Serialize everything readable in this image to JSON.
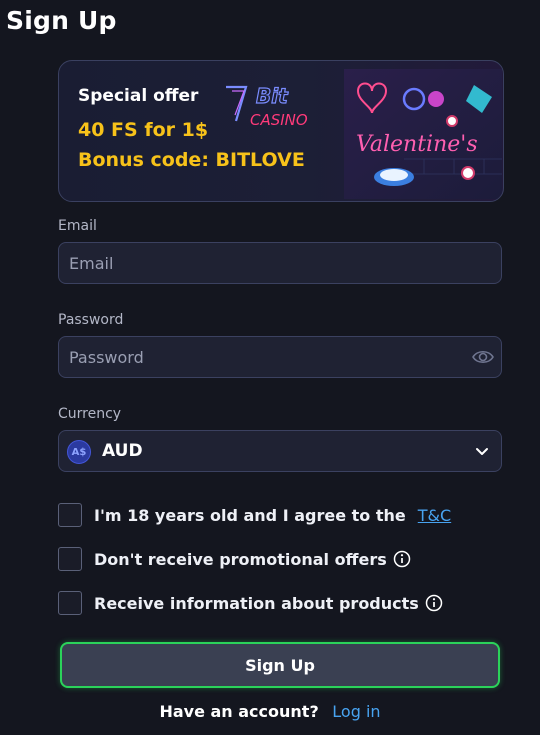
{
  "header": {
    "title": "Sign Up"
  },
  "promo": {
    "special_label": "Special offer",
    "free_spins": "40 FS for 1$",
    "bonus_code": "Bonus code: BITLOVE",
    "logo_text_top": "Bit",
    "logo_text_bottom": "CASINO",
    "valentine_text": "Valentine's"
  },
  "form": {
    "email": {
      "label": "Email",
      "placeholder": "Email"
    },
    "password": {
      "label": "Password",
      "placeholder": "Password"
    },
    "currency": {
      "label": "Currency",
      "badge": "A$",
      "value": "AUD"
    }
  },
  "checkboxes": {
    "age": {
      "label": "I'm 18 years old and I agree to the",
      "link": "T&C",
      "checked": false
    },
    "no_promo": {
      "label": "Don't receive promotional offers",
      "checked": false
    },
    "product_info": {
      "label": "Receive information about products",
      "checked": false
    }
  },
  "actions": {
    "signup_label": "Sign Up",
    "have_account": "Have an account?",
    "login_label": "Log in"
  },
  "icons": {
    "eye": "eye-icon",
    "chevron": "chevron-down-icon",
    "info": "info-icon"
  },
  "colors": {
    "background": "#14161f",
    "accent_yellow": "#f7c21a",
    "link_blue": "#48a3f0",
    "button_border_green": "#2bd35a"
  }
}
